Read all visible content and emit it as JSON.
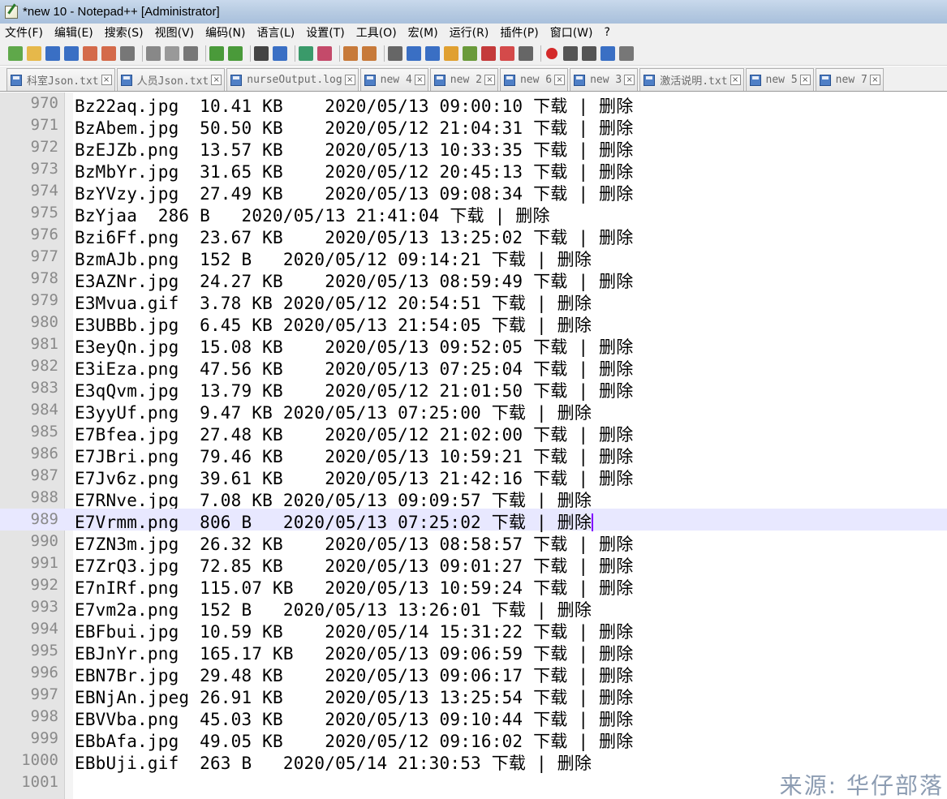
{
  "window": {
    "title": "*new 10 - Notepad++ [Administrator]"
  },
  "menu": [
    "文件(F)",
    "编辑(E)",
    "搜索(S)",
    "视图(V)",
    "编码(N)",
    "语言(L)",
    "设置(T)",
    "工具(O)",
    "宏(M)",
    "运行(R)",
    "插件(P)",
    "窗口(W)",
    "?"
  ],
  "tabs": [
    {
      "label": "科室Json.txt"
    },
    {
      "label": "人员Json.txt"
    },
    {
      "label": "nurseOutput.log"
    },
    {
      "label": "new 4"
    },
    {
      "label": "new 2"
    },
    {
      "label": "new 6"
    },
    {
      "label": "new 3"
    },
    {
      "label": "激活说明.txt"
    },
    {
      "label": "new 5"
    },
    {
      "label": "new 7"
    }
  ],
  "editor": {
    "current_line": "989",
    "lines": [
      {
        "num": "970",
        "text": "Bz22aq.jpg  10.41 KB    2020/05/13 09:00:10 下载 | 删除"
      },
      {
        "num": "971",
        "text": "BzAbem.jpg  50.50 KB    2020/05/12 21:04:31 下载 | 删除"
      },
      {
        "num": "972",
        "text": "BzEJZb.png  13.57 KB    2020/05/13 10:33:35 下载 | 删除"
      },
      {
        "num": "973",
        "text": "BzMbYr.jpg  31.65 KB    2020/05/12 20:45:13 下载 | 删除"
      },
      {
        "num": "974",
        "text": "BzYVzy.jpg  27.49 KB    2020/05/13 09:08:34 下载 | 删除"
      },
      {
        "num": "975",
        "text": "BzYjaa  286 B   2020/05/13 21:41:04 下载 | 删除"
      },
      {
        "num": "976",
        "text": "Bzi6Ff.png  23.67 KB    2020/05/13 13:25:02 下载 | 删除"
      },
      {
        "num": "977",
        "text": "BzmAJb.png  152 B   2020/05/12 09:14:21 下载 | 删除"
      },
      {
        "num": "978",
        "text": "E3AZNr.jpg  24.27 KB    2020/05/13 08:59:49 下载 | 删除"
      },
      {
        "num": "979",
        "text": "E3Mvua.gif  3.78 KB 2020/05/12 20:54:51 下载 | 删除"
      },
      {
        "num": "980",
        "text": "E3UBBb.jpg  6.45 KB 2020/05/13 21:54:05 下载 | 删除"
      },
      {
        "num": "981",
        "text": "E3eyQn.jpg  15.08 KB    2020/05/13 09:52:05 下载 | 删除"
      },
      {
        "num": "982",
        "text": "E3iEza.png  47.56 KB    2020/05/13 07:25:04 下载 | 删除"
      },
      {
        "num": "983",
        "text": "E3qQvm.jpg  13.79 KB    2020/05/12 21:01:50 下载 | 删除"
      },
      {
        "num": "984",
        "text": "E3yyUf.png  9.47 KB 2020/05/13 07:25:00 下载 | 删除"
      },
      {
        "num": "985",
        "text": "E7Bfea.jpg  27.48 KB    2020/05/12 21:02:00 下载 | 删除"
      },
      {
        "num": "986",
        "text": "E7JBri.png  79.46 KB    2020/05/13 10:59:21 下载 | 删除"
      },
      {
        "num": "987",
        "text": "E7Jv6z.png  39.61 KB    2020/05/13 21:42:16 下载 | 删除"
      },
      {
        "num": "988",
        "text": "E7RNve.jpg  7.08 KB 2020/05/13 09:09:57 下载 | 删除"
      },
      {
        "num": "989",
        "text": "E7Vrmm.png  806 B   2020/05/13 07:25:02 下载 | 删除"
      },
      {
        "num": "990",
        "text": "E7ZN3m.jpg  26.32 KB    2020/05/13 08:58:57 下载 | 删除"
      },
      {
        "num": "991",
        "text": "E7ZrQ3.jpg  72.85 KB    2020/05/13 09:01:27 下载 | 删除"
      },
      {
        "num": "992",
        "text": "E7nIRf.png  115.07 KB   2020/05/13 10:59:24 下载 | 删除"
      },
      {
        "num": "993",
        "text": "E7vm2a.png  152 B   2020/05/13 13:26:01 下载 | 删除"
      },
      {
        "num": "994",
        "text": "EBFbui.jpg  10.59 KB    2020/05/14 15:31:22 下载 | 删除"
      },
      {
        "num": "995",
        "text": "EBJnYr.png  165.17 KB   2020/05/13 09:06:59 下载 | 删除"
      },
      {
        "num": "996",
        "text": "EBN7Br.jpg  29.48 KB    2020/05/13 09:06:17 下载 | 删除"
      },
      {
        "num": "997",
        "text": "EBNjAn.jpeg 26.91 KB    2020/05/13 13:25:54 下载 | 删除"
      },
      {
        "num": "998",
        "text": "EBVVba.png  45.03 KB    2020/05/13 09:10:44 下载 | 删除"
      },
      {
        "num": "999",
        "text": "EBbAfa.jpg  49.05 KB    2020/05/12 09:16:02 下载 | 删除"
      },
      {
        "num": "1000",
        "text": "EBbUji.gif  263 B   2020/05/14 21:30:53 下载 | 删除"
      },
      {
        "num": "1001",
        "text": ""
      }
    ]
  },
  "watermark": "来源: 华仔部落",
  "toolbar_icons": [
    "new-file-icon",
    "open-file-icon",
    "save-icon",
    "save-all-icon",
    "close-icon",
    "close-all-icon",
    "print-icon",
    "cut-icon",
    "copy-icon",
    "paste-icon",
    "undo-icon",
    "redo-icon",
    "find-icon",
    "replace-icon",
    "zoom-in-icon",
    "zoom-out-icon",
    "sync-vertical-icon",
    "sync-horizontal-icon",
    "word-wrap-icon",
    "show-all-chars-icon",
    "indent-guide-icon",
    "doc-map-icon",
    "function-list-icon",
    "folder-workspace-icon",
    "monitoring-icon",
    "stop-icon",
    "record-macro-icon",
    "stop-record-icon",
    "play-macro-icon",
    "run-macro-multiple-icon",
    "save-macro-icon"
  ]
}
